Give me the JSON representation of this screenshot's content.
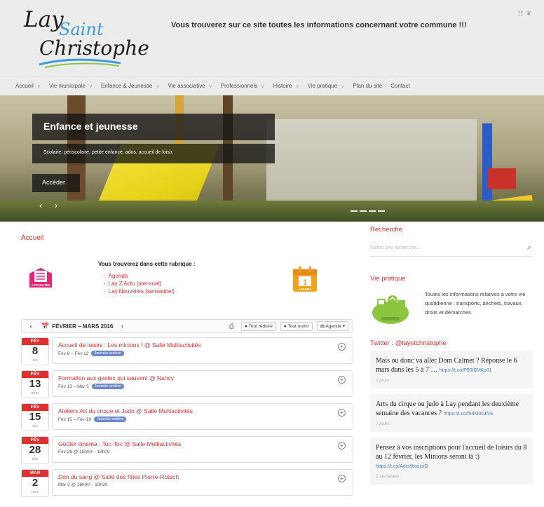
{
  "header": {
    "logo_line1": "Lay",
    "logo_line2": "Saint",
    "logo_line3": "Christophe",
    "tagline": "Vous trouverez sur ce site toutes les informations concernant votre commune !!!",
    "social_icons": [
      "rss-icon",
      "twitter-icon"
    ]
  },
  "nav": {
    "items": [
      {
        "label": "Accueil",
        "has_menu": true
      },
      {
        "label": "Vie municipale",
        "has_menu": true
      },
      {
        "label": "Enfance & Jeunesse",
        "has_menu": true
      },
      {
        "label": "Vie associative",
        "has_menu": true
      },
      {
        "label": "Professionnels",
        "has_menu": true
      },
      {
        "label": "Histoire",
        "has_menu": true
      },
      {
        "label": "Vie pratique",
        "has_menu": true
      },
      {
        "label": "Plan du site",
        "has_menu": false
      },
      {
        "label": "Contact",
        "has_menu": false
      }
    ]
  },
  "hero": {
    "title": "Enfance et jeunesse",
    "description": "Scolaire, périscolaire, petite enfance, ados, accueil de loisir.",
    "button": "Accéder"
  },
  "main": {
    "breadcrumb": "Accueil",
    "rubrique_title": "Vous trouverez dans cette rubrique :",
    "rubrique_links": [
      "Agenda",
      "Lay Z'Actu (mensuel)",
      "Lay Nouvelles (semestriel)"
    ],
    "actualites_icon_label": "ACTUALITÉS",
    "agenda_icon_label": "AGENDA",
    "agenda_icon_day": "1"
  },
  "agenda": {
    "range": "FÉVRIER – MARS 2016",
    "collapse_all": "Tout réduire",
    "expand_all": "Tout ouvrir",
    "view": "Agenda",
    "events": [
      {
        "month": "FÉV",
        "day": "8",
        "weekday": "lun",
        "title": "Accueil de loisirs : Les minions ! @ Salle Multiactivités",
        "when": "Fév 8 – Fév 12",
        "tag": "Journée entière"
      },
      {
        "month": "FÉV",
        "day": "13",
        "weekday": "sam",
        "title": "Formation aux gestes qui sauvent @ Nancy",
        "when": "Fév 13 – Mar 5",
        "tag": "Journée entière"
      },
      {
        "month": "FÉV",
        "day": "15",
        "weekday": "lun",
        "title": "Ateliers Art du cirque et Judo @ Salle Multiactivités",
        "when": "Fév 15 – Fév 19",
        "tag": "Journée entière"
      },
      {
        "month": "FÉV",
        "day": "28",
        "weekday": "dim",
        "title": "Goûter cinéma : Toc-Toc @ Salle Multiactivités",
        "when": "Fév 28 @ 15h00 – 18h00",
        "tag": ""
      },
      {
        "month": "MAR",
        "day": "2",
        "weekday": "mer",
        "title": "Don du sang @ Salle des fêtes Pierre-Rotach",
        "when": "Mar 2 @ 16h00 – 19h30",
        "tag": ""
      }
    ]
  },
  "sidebar": {
    "search_title": "Recherche",
    "search_placeholder": "Faites une recherche...",
    "vie_pratique_title": "Vie pratique",
    "vie_pratique_text": "Toutes les informations relatives à votre vie quotidienne : transports, déchets, travaux, droits et démarches.",
    "twitter_title": "Twitter : @laystchristophe",
    "tweets": [
      {
        "text": "Mais ou donc va aller Dom Calmet ? Réponse le 6 mars dans les 5 à 7 …",
        "link": "https://t.co/P50IDVKo01",
        "time": "2 jours"
      },
      {
        "text": "Arts du cirque ou judo à Lay pendant les deuxième semaine des vacances ?",
        "link": "https://t.co/f69M0GtNS",
        "time": "7 jours"
      },
      {
        "text": "Pensez à vos inscriptions pour l'accueil de loisirs du 8 au 12 février, les Minions seront là :)",
        "link": "https://t.co/AdrsWozzxD",
        "time": "2 semaines"
      }
    ]
  },
  "colors": {
    "accent": "#e0302f",
    "orange": "#f2a21e",
    "pink": "#e5247a",
    "green": "#8cc63e",
    "tag_blue": "#6c88c9"
  }
}
